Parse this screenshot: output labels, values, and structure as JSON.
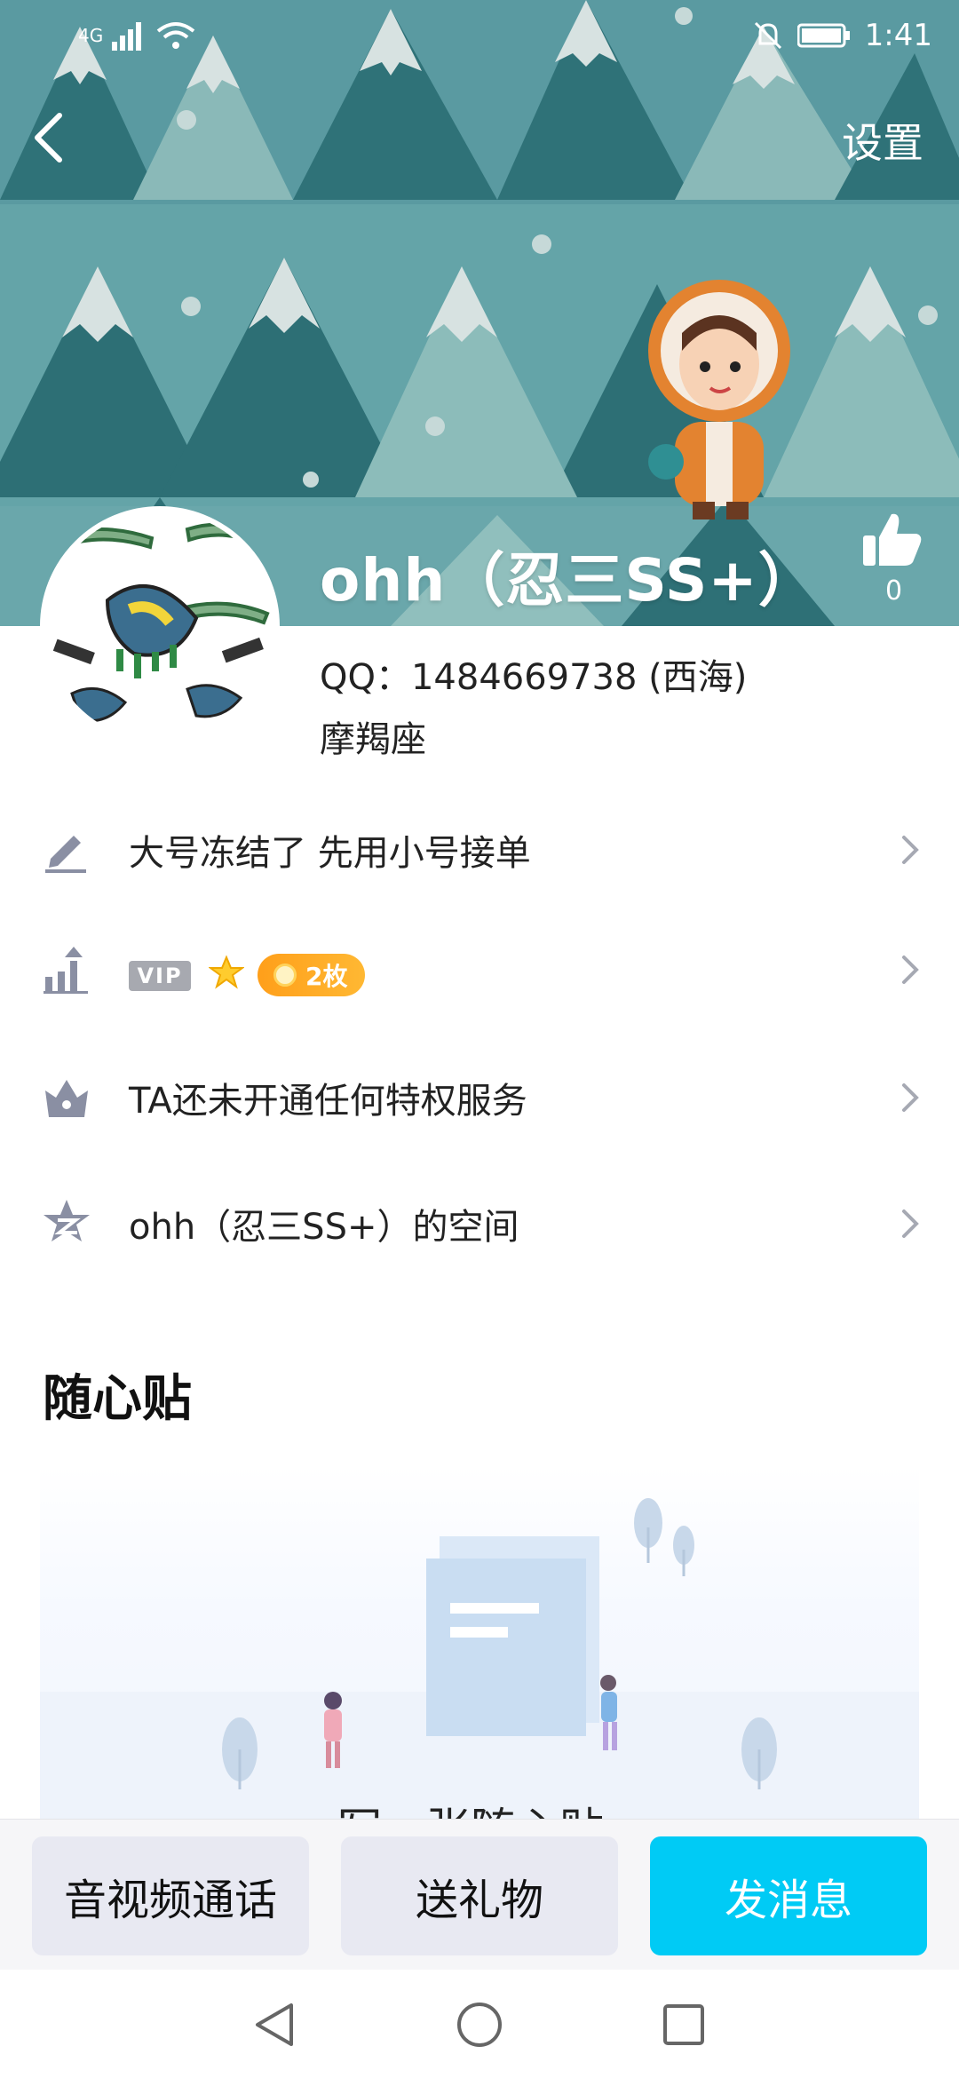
{
  "status_bar": {
    "network": "4G",
    "time": "1:41"
  },
  "header": {
    "back_icon": "chevron-left-icon",
    "settings_label": "设置"
  },
  "profile": {
    "nickname": "ohh（忍三SS+）",
    "likes": "0",
    "qq": "QQ：1484669738 (西海)",
    "zodiac": "摩羯座"
  },
  "rows": [
    {
      "icon": "pencil-icon",
      "text": "大号冻结了  先用小号接单"
    },
    {
      "icon": "level-up-icon",
      "vip_label": "VIP",
      "medal_label": "2枚"
    },
    {
      "icon": "crown-icon",
      "text": "TA还未开通任何特权服务"
    },
    {
      "icon": "qzone-star-icon",
      "text": "ohh（忍三SS+）的空间"
    }
  ],
  "sticky": {
    "title": "随心贴",
    "caption": "写一张随心贴"
  },
  "bottom_buttons": {
    "call": "音视频通话",
    "gift": "送礼物",
    "message": "发消息"
  },
  "colors": {
    "accent": "#00cbf5",
    "banner": "#5c9ba1"
  }
}
